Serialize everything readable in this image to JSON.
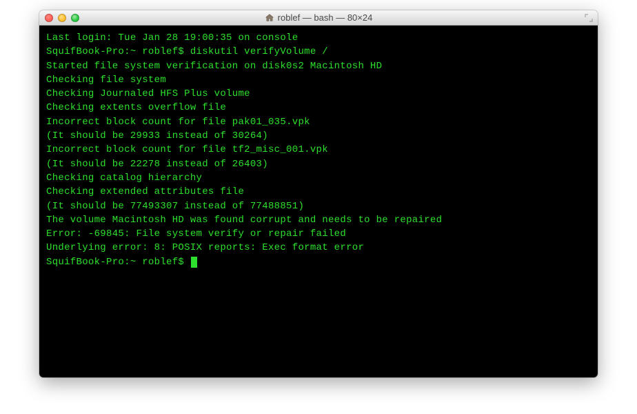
{
  "window": {
    "title": "roblef — bash — 80×24"
  },
  "terminal": {
    "lines": [
      "Last login: Tue Jan 28 19:00:35 on console",
      "SquifBook-Pro:~ roblef$ diskutil verifyVolume /",
      "Started file system verification on disk0s2 Macintosh HD",
      "Checking file system",
      "Checking Journaled HFS Plus volume",
      "Checking extents overflow file",
      "Incorrect block count for file pak01_035.vpk",
      "(It should be 29933 instead of 30264)",
      "Incorrect block count for file tf2_misc_001.vpk",
      "(It should be 22278 instead of 26403)",
      "Checking catalog hierarchy",
      "Checking extended attributes file",
      "(It should be 77493307 instead of 77488851)",
      "The volume Macintosh HD was found corrupt and needs to be repaired",
      "Error: -69845: File system verify or repair failed",
      "Underlying error: 8: POSIX reports: Exec format error"
    ],
    "prompt": "SquifBook-Pro:~ roblef$ "
  }
}
